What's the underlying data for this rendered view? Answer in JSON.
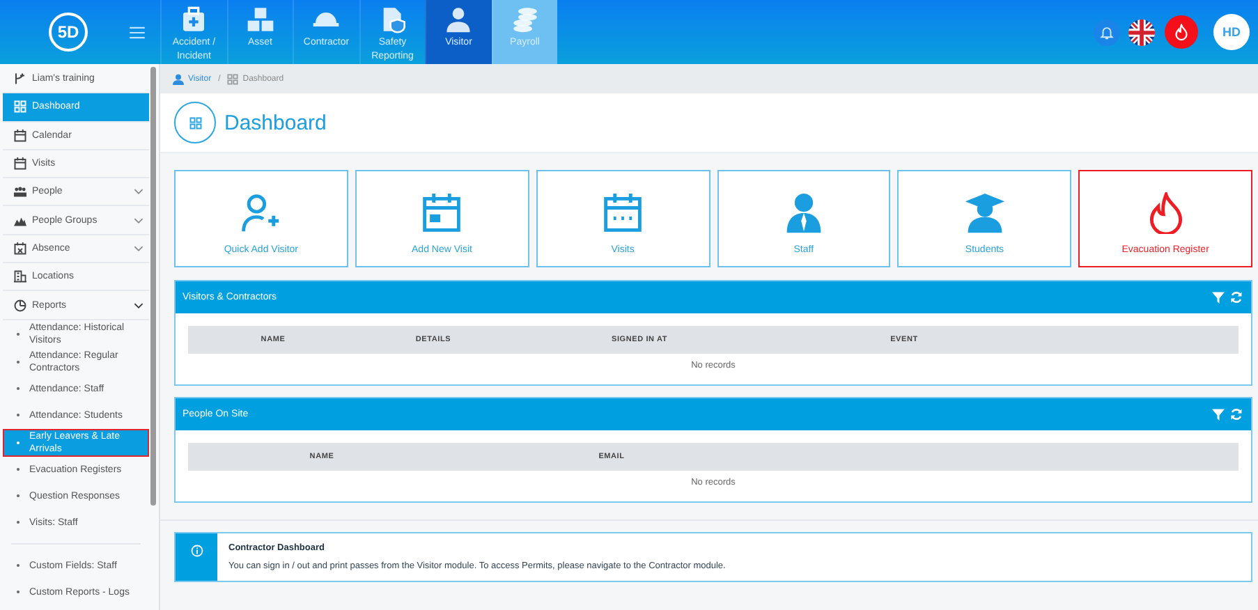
{
  "top_bar": {
    "logo": "5D",
    "modules": [
      {
        "label": "Accident / Incident",
        "selected": false,
        "hovered": false
      },
      {
        "label": "Asset",
        "selected": false,
        "hovered": false
      },
      {
        "label": "Contractor",
        "selected": false,
        "hovered": false
      },
      {
        "label": "Safety Reporting",
        "selected": false,
        "hovered": false
      },
      {
        "label": "Visitor",
        "selected": true,
        "hovered": false
      },
      {
        "label": "Payroll",
        "selected": false,
        "hovered": true
      }
    ],
    "avatar": "HD"
  },
  "sidebar": {
    "items": [
      {
        "label": "Liam's training",
        "kind": "branch",
        "selected": false
      },
      {
        "label": "Dashboard",
        "kind": "dashboard",
        "selected": true
      },
      {
        "label": "Calendar",
        "kind": "calendar",
        "selected": false
      },
      {
        "label": "Visits",
        "kind": "visits",
        "selected": false
      },
      {
        "label": "People",
        "kind": "people",
        "selected": false,
        "expanded": false
      },
      {
        "label": "People Groups",
        "kind": "groups",
        "selected": false,
        "expanded": false
      },
      {
        "label": "Absence",
        "kind": "absence",
        "selected": false,
        "expanded": false
      },
      {
        "label": "Locations",
        "kind": "locations",
        "selected": false
      },
      {
        "label": "Reports",
        "kind": "reports",
        "selected": false,
        "expanded": true,
        "children": [
          {
            "label": "Attendance: Historical Visitors",
            "selected": false
          },
          {
            "label": "Attendance: Regular Contractors",
            "selected": false
          },
          {
            "label": "Attendance: Staff",
            "selected": false
          },
          {
            "label": "Attendance: Students",
            "selected": false
          },
          {
            "label": "Early Leavers & Late Arrivals",
            "selected": true
          },
          {
            "label": "Evacuation Registers",
            "selected": false
          },
          {
            "label": "Question Responses",
            "selected": false
          },
          {
            "label": "Visits: Staff",
            "selected": false
          }
        ]
      }
    ],
    "extra_items": [
      {
        "label": "Custom Fields: Staff",
        "selected": false
      },
      {
        "label": "Custom Reports - Logs",
        "selected": false
      }
    ]
  },
  "breadcrumb": {
    "separator": "/",
    "items": [
      "Visitor",
      "Dashboard"
    ]
  },
  "page_title": "Dashboard",
  "tiles": [
    {
      "label": "Quick Add Visitor",
      "kind": "add-person"
    },
    {
      "label": "Add New Visit",
      "kind": "add-visit"
    },
    {
      "label": "Visits",
      "kind": "visits"
    },
    {
      "label": "Staff",
      "kind": "staff"
    },
    {
      "label": "Students",
      "kind": "students"
    },
    {
      "label": "Evacuation Register",
      "kind": "alert"
    }
  ],
  "panels": [
    {
      "title": "Visitors & Contractors",
      "columns": [
        "NAME",
        "DETAILS",
        "SIGNED IN AT",
        "EVENT"
      ],
      "empty_text": "No records"
    },
    {
      "title": "People On Site",
      "columns": [
        "NAME",
        "EMAIL"
      ],
      "empty_text": "No records"
    }
  ],
  "info": {
    "title": "Contractor Dashboard",
    "text": "You can sign in / out and print passes from the Visitor module. To access Permits, please navigate to the Contractor module."
  }
}
